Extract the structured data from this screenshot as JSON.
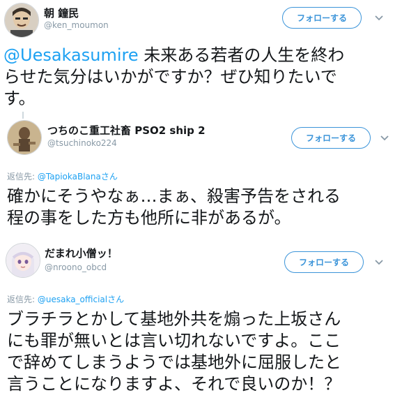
{
  "tweets": [
    {
      "name": "朝 鐘民",
      "handle": "@ken_moumon",
      "follow_label": "フォローする",
      "mention": "@Uesakasumire",
      "text_lines": [
        "未来ある若者の人生を終わ",
        "らせた気分はいかがですか？ぜひ知りたいで",
        "す。"
      ]
    },
    {
      "name": "つちのこ重工社畜 PSO2 ship 2",
      "handle": "@tsuchinoko224",
      "follow_label": "フォローする",
      "reply_prefix": "返信先:",
      "reply_mention": "@TapiokaBlanaさん",
      "text_lines": [
        "確かにそうやなぁ…まぁ、殺害予告をされる",
        "程の事をした方も他所に非があるが。"
      ]
    },
    {
      "name": "だまれ小僧ッ！",
      "handle": "@nroono_obcd",
      "follow_label": "フォローする",
      "reply_prefix": "返信先:",
      "reply_mention": "@uesaka_officialさん",
      "text_lines": [
        "ブラチラとかして基地外共を煽った上坂さん",
        "にも罪が無いとは言い切れないですよ。ここ",
        "で辞めてしまうようでは基地外に屈服したと",
        "言うことになりますよ、それで良いのか！？"
      ]
    }
  ],
  "icons": {
    "caret": "chevron-down-icon"
  },
  "colors": {
    "accent": "#1da1f2",
    "button_border": "#3b94d9",
    "muted": "#8899a6"
  }
}
